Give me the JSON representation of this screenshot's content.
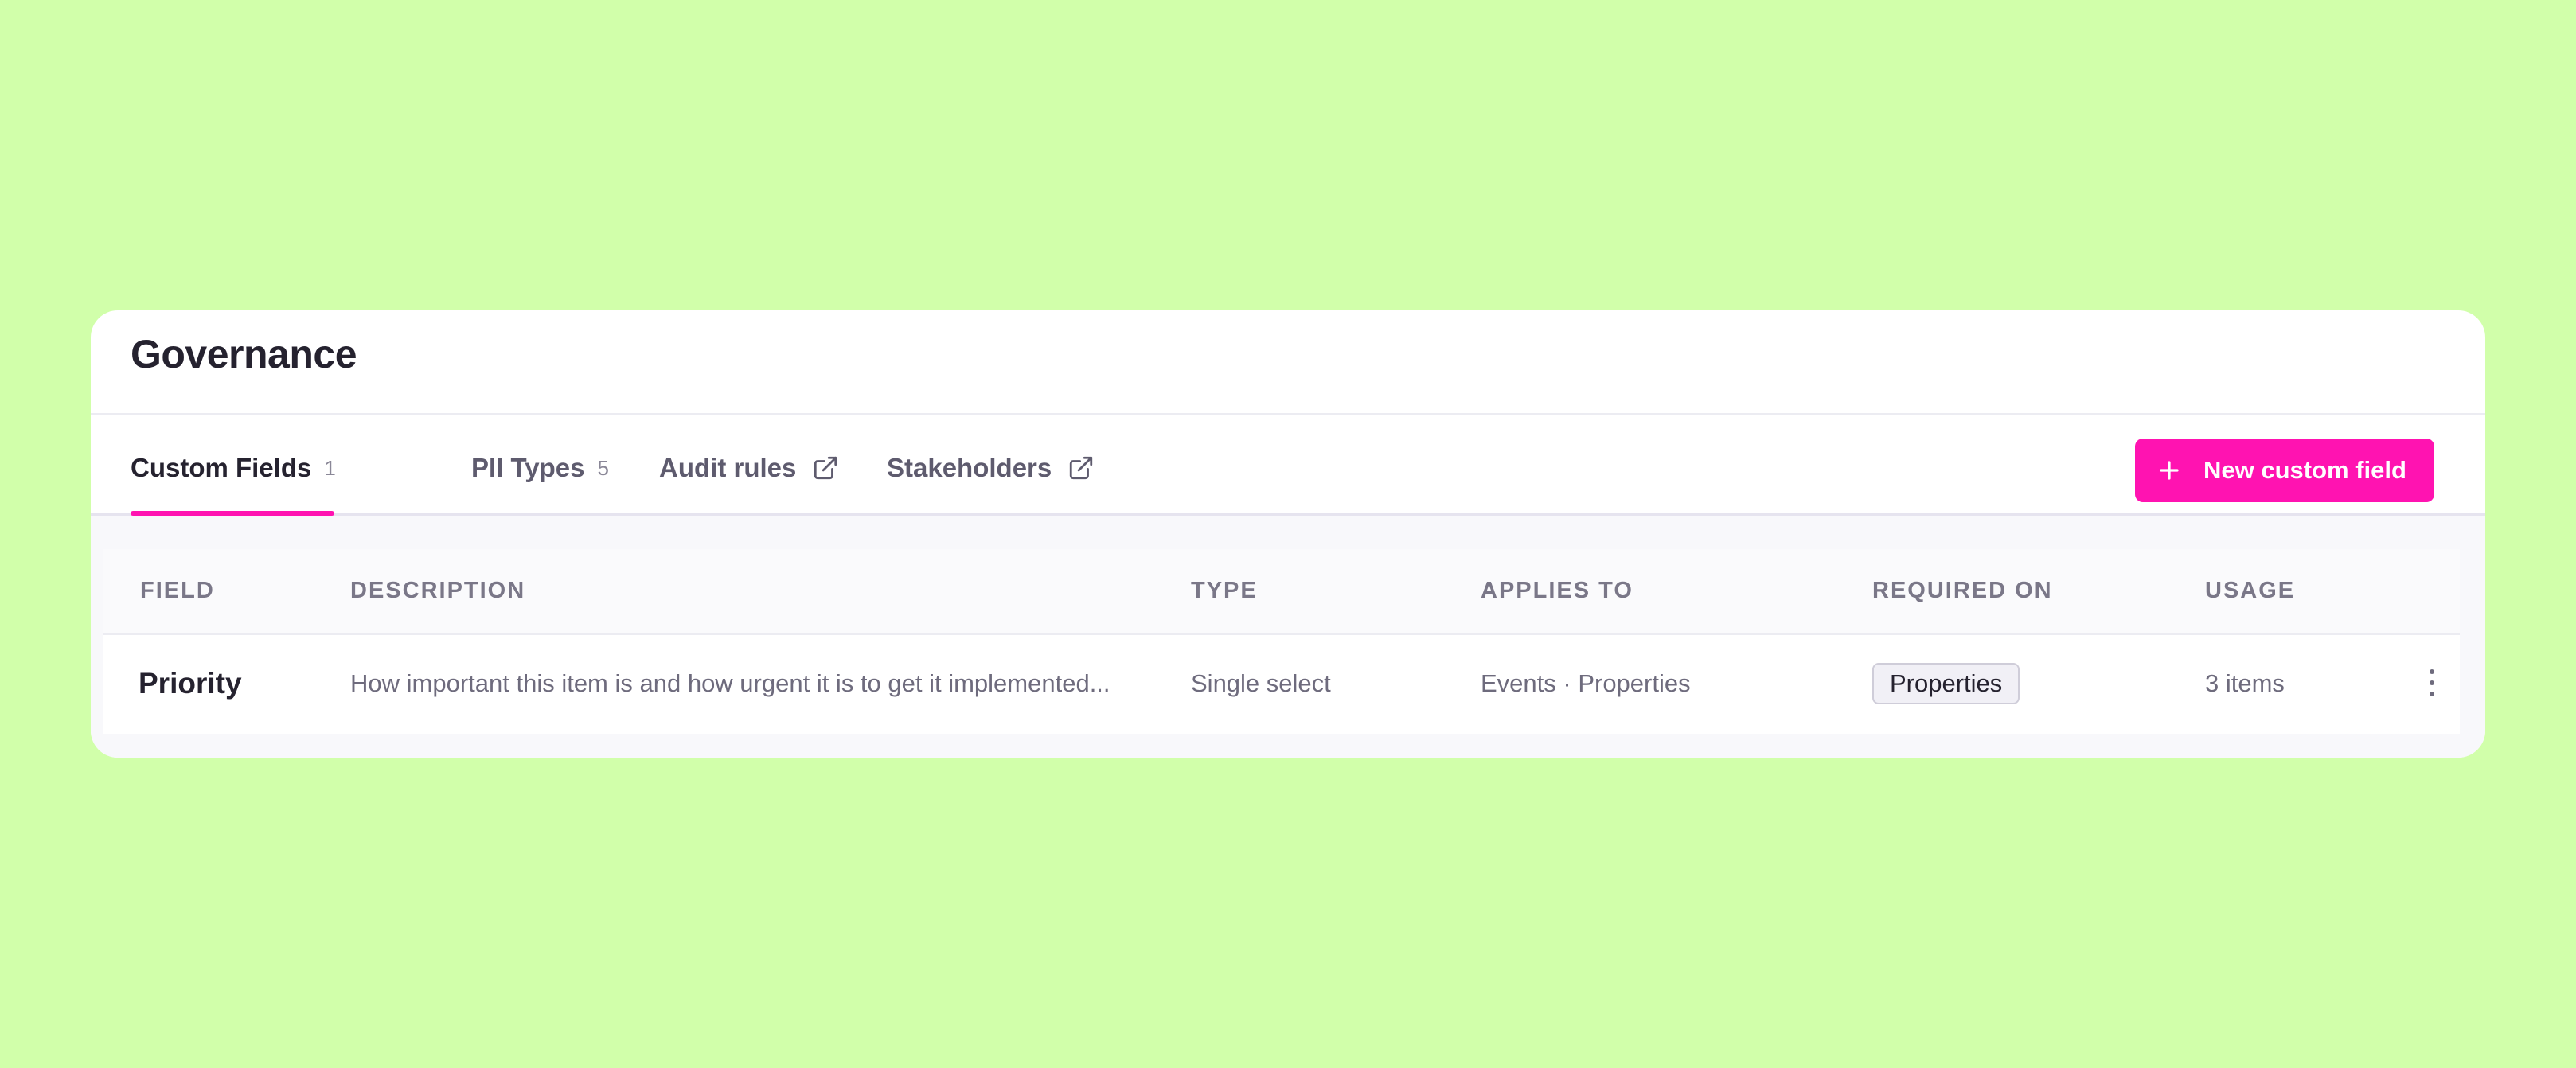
{
  "page": {
    "title": "Governance"
  },
  "tabs": [
    {
      "label": "Custom Fields",
      "count": "1",
      "active": true
    },
    {
      "label": "PII Types",
      "count": "5",
      "active": false
    },
    {
      "label": "Audit rules",
      "icon": "external-link-icon",
      "active": false
    },
    {
      "label": "Stakeholders",
      "icon": "external-link-icon",
      "active": false
    }
  ],
  "actions": {
    "new_custom_field_label": "New custom field",
    "new_custom_field_icon": "plus-icon"
  },
  "table": {
    "columns": [
      "FIELD",
      "DESCRIPTION",
      "TYPE",
      "APPLIES TO",
      "REQUIRED ON",
      "USAGE"
    ],
    "rows": [
      {
        "field": "Priority",
        "description": "How important this item is and how urgent it is to get it implemented...",
        "type": "Single select",
        "applies_to": "Events · Properties",
        "required_on": "Properties",
        "usage": "3 items",
        "menu_icon": "more-vertical-icon"
      }
    ]
  },
  "colors": {
    "background": "#d1ffaa",
    "accent": "#ff13b1",
    "title_text": "#25222f"
  }
}
